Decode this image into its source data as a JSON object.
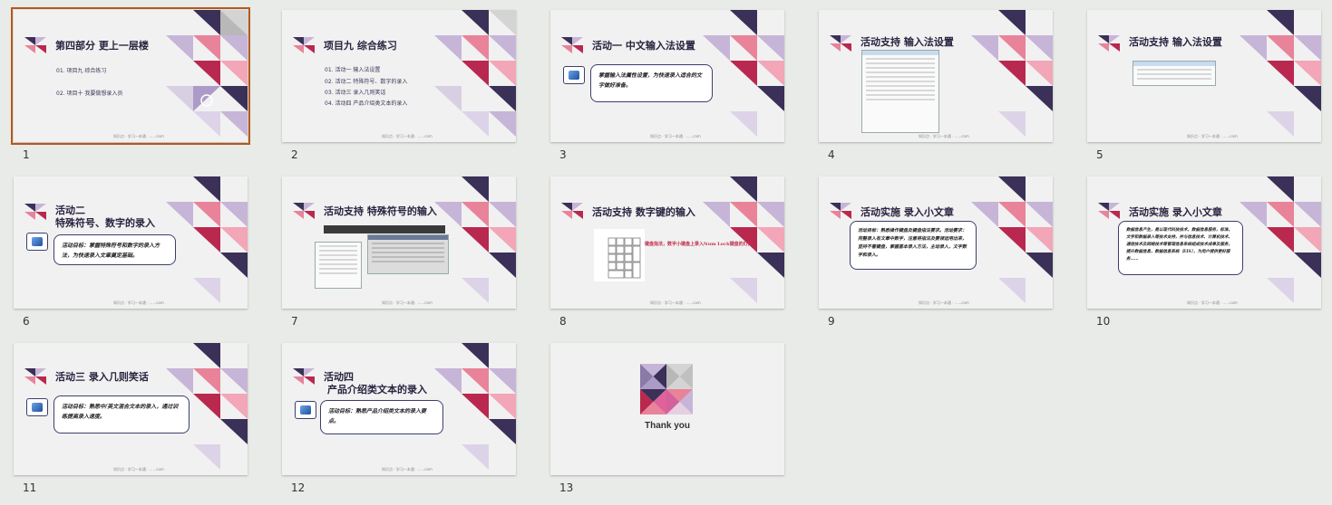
{
  "slides": [
    {
      "number": "1",
      "title": "第四部分  更上一层楼",
      "lines": [
        "01. 项目九  综合练习",
        "02. 项目十  我要做想录入员"
      ],
      "footer": "知识点 · 学习一本通 · ......com"
    },
    {
      "number": "2",
      "title": "项目九     综合练习",
      "lines": [
        "01. 活动一  输入法设置",
        "02. 活动二  特殊符号、数字的录入",
        "03. 活动三  录入几则笑话",
        "04. 活动四  产品介绍类文本的录入"
      ],
      "footer": "知识点 · 学习一本通 · ......com"
    },
    {
      "number": "3",
      "title": "活动一   中文输入法设置",
      "box": "掌握输入法属性设置，为快速录入适合的文字做好准备。",
      "footer": "知识点 · 学习一本通 · ......com"
    },
    {
      "number": "4",
      "title": "活动支持    输入法设置",
      "footer": "知识点 · 学习一本通 · ......com"
    },
    {
      "number": "5",
      "title": "活动支持    输入法设置",
      "footer": "知识点 · 学习一本通 · ......com"
    },
    {
      "number": "6",
      "title": "活动二",
      "title2": "特殊符号、数字的录入",
      "box": "活动目标：掌握特殊符号和数字的录入方法，为快速录入文章奠定基础。",
      "footer": "知识点 · 学习一本通 · ......com"
    },
    {
      "number": "7",
      "title": "活动支持    特殊符号的输入",
      "footer": "知识点 · 学习一本通 · ......com"
    },
    {
      "number": "8",
      "title": "活动支持    数字键的输入",
      "red": "键盘指法，数字小键盘上录入Num Lock键盘的灯亮。",
      "footer": "知识点 · 学习一本通 · ......com"
    },
    {
      "number": "9",
      "title": "活动实施    录入小文章",
      "box": "活动目标：熟悉操作键盘及键盘指法要求。活动要求：完整录入有文章中数字，注意将指法及要领运用出来，坚持不看键盘，掌握基本录入方法，主动录入，文字数字和录入。",
      "footer": "知识点 · 学习一本通 · ......com"
    },
    {
      "number": "10",
      "title": "活动实施    录入小文章",
      "box": "数据信息产生，是以现代科技技术，数据信息服务，标准，文字和数据录入等技术支持，并与信息技术、计算机技术、通信技术及网络技术等管理信息系统组成技术成果及服务，提升数据信息，数据信息系统（EIS），为用户提供更好服务……",
      "footer": "知识点 · 学习一本通 · ......com"
    },
    {
      "number": "11",
      "title": "活动三   录入几则笑话",
      "box": "活动目标：熟悉中/英文混合文本的录入，通过训练提高录入速度。",
      "footer": "知识点 · 学习一本通 · ......com"
    },
    {
      "number": "12",
      "title": "活动四",
      "title2": "产品介绍类文本的录入",
      "box": "活动目标：熟悉产品介绍类文本的录入要点。",
      "footer": "知识点 · 学习一本通 · ......com"
    },
    {
      "number": "13",
      "title": "Thank you"
    }
  ],
  "colors": {
    "selection": "#b5581d",
    "navy": "#3b3057",
    "pink": "#e8839a",
    "crimson": "#b9284f",
    "lavender": "#c7b5d8"
  },
  "icons": {
    "deco": "triangle-mosaic",
    "keypad": "numeric-keypad-image",
    "keyboard": "soft-keyboard-image",
    "dialog": "settings-dialog-image"
  }
}
